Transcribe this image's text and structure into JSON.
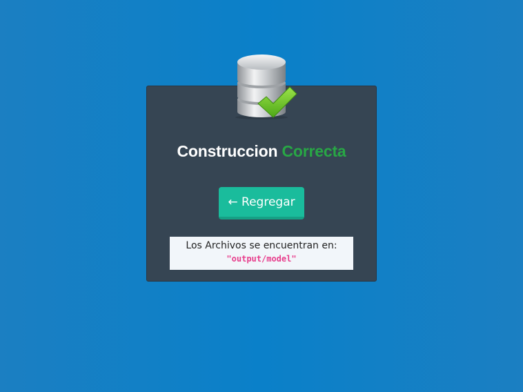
{
  "header": {
    "title_main": "Construccion",
    "title_status": "Correcta",
    "status_color": "#28a745",
    "icon": "database-check-icon"
  },
  "actions": {
    "back_label": "← Regregar"
  },
  "info": {
    "text": "Los Archivos se encuentran en:",
    "path": "\"output/model\""
  },
  "colors": {
    "background": "#0a80c9",
    "card": "#364553",
    "button": "#1abc9c",
    "path": "#e83e8c"
  }
}
